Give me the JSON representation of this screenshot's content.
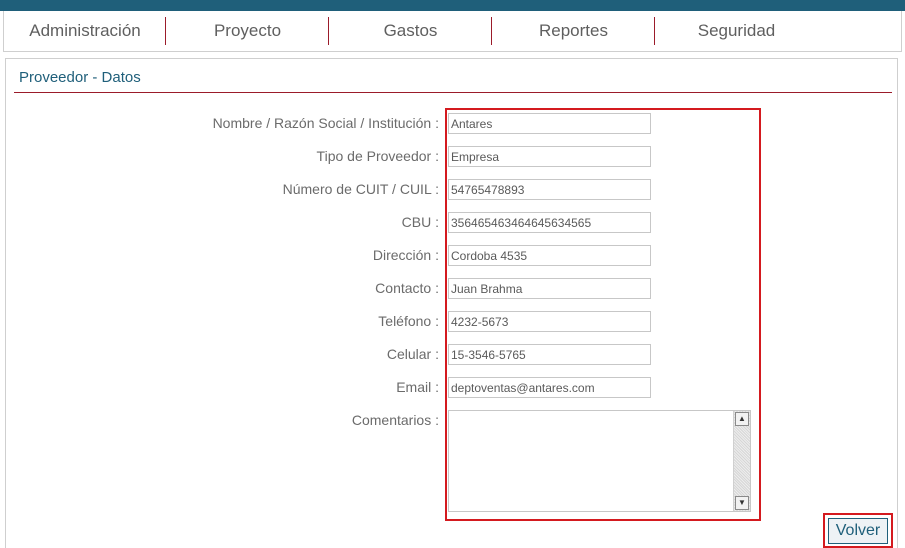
{
  "nav": {
    "tabs": [
      {
        "label": "Administración"
      },
      {
        "label": "Proyecto"
      },
      {
        "label": "Gastos"
      },
      {
        "label": "Reportes"
      },
      {
        "label": "Seguridad"
      }
    ]
  },
  "panel": {
    "title": "Proveedor - Datos"
  },
  "form": {
    "fields": [
      {
        "label": "Nombre / Razón Social / Institución :",
        "value": "Antares"
      },
      {
        "label": "Tipo de Proveedor :",
        "value": "Empresa"
      },
      {
        "label": "Número de CUIT / CUIL :",
        "value": "54765478893"
      },
      {
        "label": "CBU :",
        "value": "356465463464645634565"
      },
      {
        "label": "Dirección :",
        "value": "Cordoba 4535"
      },
      {
        "label": "Contacto :",
        "value": "Juan Brahma"
      },
      {
        "label": "Teléfono :",
        "value": "4232-5673"
      },
      {
        "label": "Celular :",
        "value": "15-3546-5765"
      },
      {
        "label": "Email :",
        "value": "deptoventas@antares.com"
      }
    ],
    "comments": {
      "label": "Comentarios :",
      "value": ""
    }
  },
  "actions": {
    "back_label": "Volver"
  },
  "icons": {
    "scroll_up": "scroll-up-arrow-icon",
    "scroll_down": "scroll-down-arrow-icon"
  },
  "colors": {
    "header": "#1f5f7a",
    "accent": "#9b1b2a",
    "highlight": "#d41a1f"
  }
}
